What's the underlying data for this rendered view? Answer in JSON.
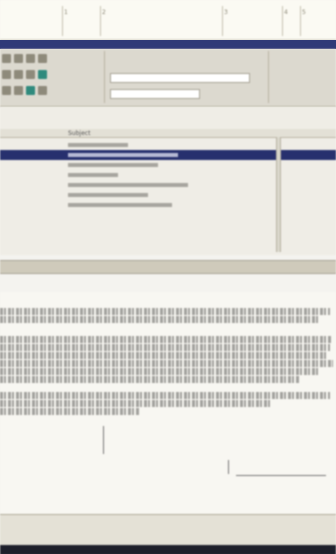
{
  "ruler": {
    "labels": [
      "1",
      "2",
      "3",
      "4",
      "5"
    ]
  },
  "toolbar": {
    "row1": [
      "",
      "",
      ""
    ],
    "field_value": ""
  },
  "list": {
    "headers": [
      "",
      "Subject",
      ""
    ],
    "rows": [
      {
        "c1": "",
        "c2": "",
        "c3": "",
        "selected": false,
        "bar": 0.3
      },
      {
        "c1": "",
        "c2": "",
        "c3": "",
        "selected": true,
        "bar": 0.55
      },
      {
        "c1": "",
        "c2": "",
        "c3": "",
        "selected": false,
        "bar": 0.45
      },
      {
        "c1": "",
        "c2": "",
        "c3": "",
        "selected": false,
        "bar": 0.25
      },
      {
        "c1": "",
        "c2": "",
        "c3": "",
        "selected": false,
        "bar": 0.6
      },
      {
        "c1": "",
        "c2": "",
        "c3": "",
        "selected": false,
        "bar": 0.4
      },
      {
        "c1": "",
        "c2": "",
        "c3": "",
        "selected": false,
        "bar": 0.52
      }
    ]
  },
  "lower": {
    "label_a": "",
    "label_b": ""
  },
  "doc": {
    "caption_a": "",
    "caption_b": ""
  },
  "status": {
    "text": ""
  },
  "colors": {
    "selection": "#27306e",
    "titlebar": "#2f3a78",
    "accent_teal": "#2f8a7d"
  }
}
